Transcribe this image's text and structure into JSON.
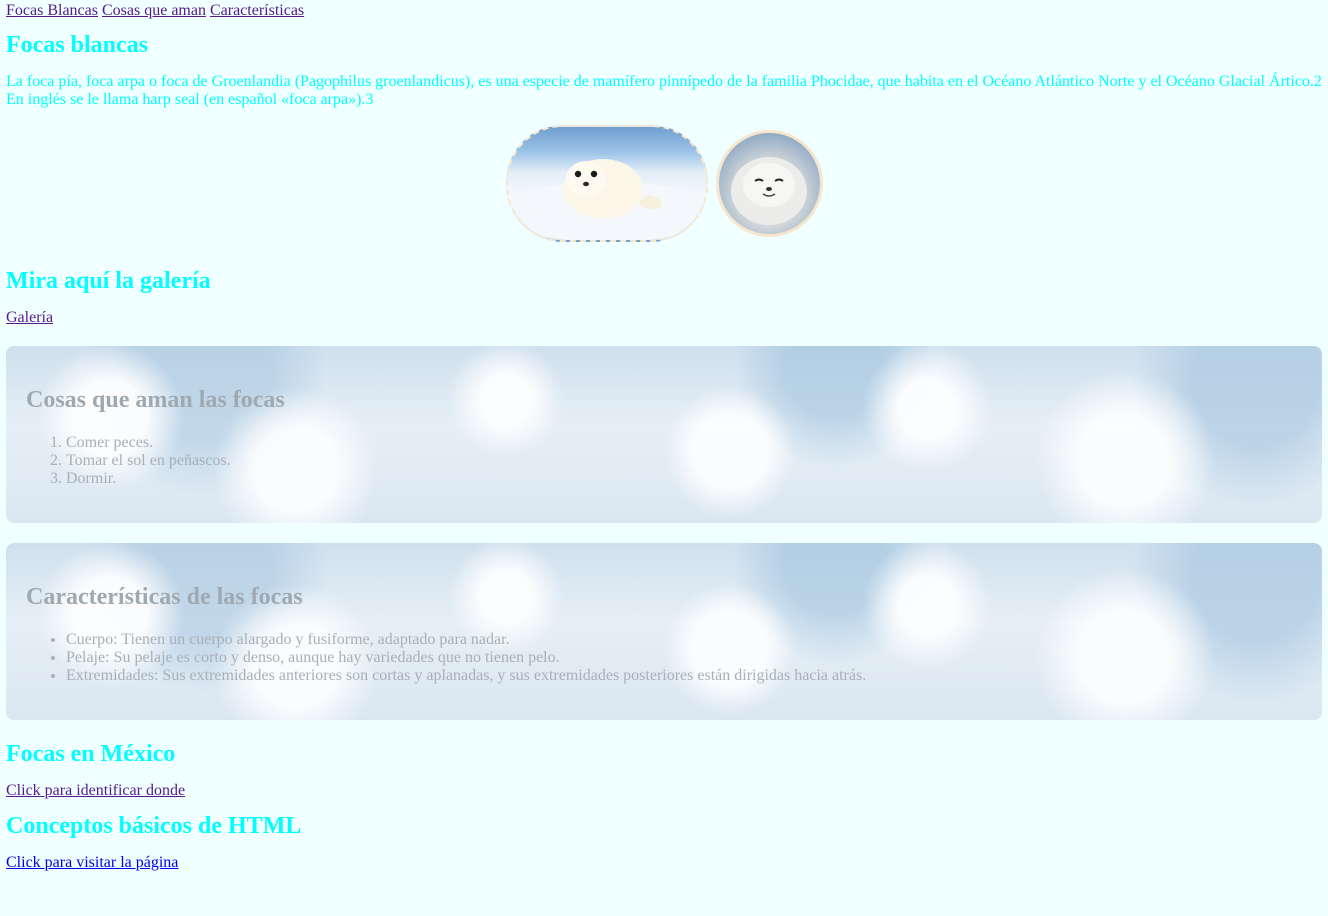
{
  "nav": {
    "links": [
      "Focas Blancas",
      "Cosas que aman",
      "Características"
    ]
  },
  "intro": {
    "title": "Focas blancas",
    "text": "La foca pía, foca arpa o foca de Groenlandia (Pagophilus groenlandicus), es una especie de mamífero pinnípedo de la familia Phocidae, que habita en el Océano Atlántico Norte y el Océano Glacial Ártico.2 En inglés se le llama harp seal (en español «foca arpa»).3"
  },
  "gallery": {
    "title": "Mira aquí la galería",
    "link": "Galería"
  },
  "loves": {
    "title": "Cosas que aman las focas",
    "items": [
      "Comer peces.",
      "Tomar el sol en peñascos.",
      "Dormir."
    ]
  },
  "features": {
    "title": "Características de las focas",
    "items": [
      "Cuerpo: Tienen un cuerpo alargado y fusiforme, adaptado para nadar.",
      "Pelaje: Su pelaje es corto y denso, aunque hay variedades que no tienen pelo.",
      "Extremidades: Sus extremidades anteriores son cortas y aplanadas, y sus extremidades posteriores están dirigidas hacia atrás."
    ]
  },
  "mexico": {
    "title": "Focas en México",
    "link": "Click para identificar donde"
  },
  "html_basics": {
    "title": "Conceptos básicos de HTML",
    "link": "Click para visitar la página"
  },
  "colors": {
    "background": "#f0ffff",
    "heading": "#00ffff",
    "visited_link": "#551a8b",
    "link": "#0000ee"
  }
}
